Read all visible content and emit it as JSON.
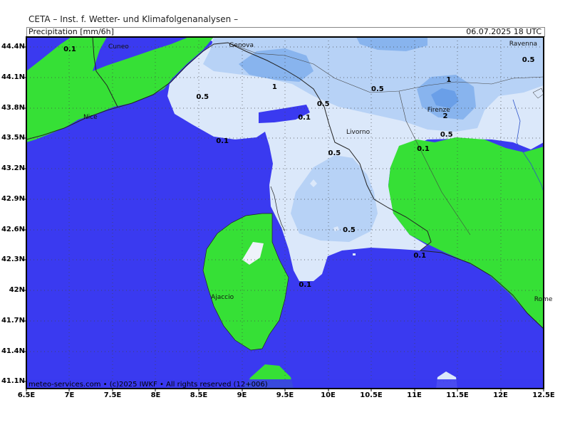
{
  "header": {
    "title": "CETA – Inst. f. Wetter- und Klimafolgenanalysen –",
    "parameter": "Precipitation [mm/6h]",
    "datetime": "06.07.2025 18 UTC"
  },
  "footer": {
    "credit": "meteo-services.com • (c)2025 IWKF • All rights reserved (12+006)"
  },
  "axes": {
    "lat_labels": [
      {
        "text": "44.4N",
        "value": 44.4
      },
      {
        "text": "44.1N",
        "value": 44.1
      },
      {
        "text": "43.8N",
        "value": 43.8
      },
      {
        "text": "43.5N",
        "value": 43.5
      },
      {
        "text": "43.2N",
        "value": 43.2
      },
      {
        "text": "42.9N",
        "value": 42.9
      },
      {
        "text": "42.6N",
        "value": 42.6
      },
      {
        "text": "42.3N",
        "value": 42.3
      },
      {
        "text": "42N",
        "value": 42.0
      },
      {
        "text": "41.7N",
        "value": 41.7
      },
      {
        "text": "41.4N",
        "value": 41.4
      },
      {
        "text": "41.1N",
        "value": 41.1
      }
    ],
    "lon_labels": [
      {
        "text": "6.5E",
        "value": 6.5
      },
      {
        "text": "7E",
        "value": 7.0
      },
      {
        "text": "7.5E",
        "value": 7.5
      },
      {
        "text": "8E",
        "value": 8.0
      },
      {
        "text": "8.5E",
        "value": 8.5
      },
      {
        "text": "9E",
        "value": 9.0
      },
      {
        "text": "9.5E",
        "value": 9.5
      },
      {
        "text": "10E",
        "value": 10.0
      },
      {
        "text": "10.5E",
        "value": 10.5
      },
      {
        "text": "11E",
        "value": 11.0
      },
      {
        "text": "11.5E",
        "value": 11.5
      },
      {
        "text": "12E",
        "value": 12.0
      },
      {
        "text": "12.5E",
        "value": 12.5
      }
    ]
  },
  "cities": [
    {
      "name": "Cuneo",
      "lon": 7.55,
      "lat": 44.39
    },
    {
      "name": "Genova",
      "lon": 8.95,
      "lat": 44.41
    },
    {
      "name": "Ravenna",
      "lon": 12.2,
      "lat": 44.42
    },
    {
      "name": "Nice",
      "lon": 7.26,
      "lat": 43.7
    },
    {
      "name": "Firenze",
      "lon": 11.25,
      "lat": 43.77
    },
    {
      "name": "Livorno",
      "lon": 10.31,
      "lat": 43.55
    },
    {
      "name": "Ajaccio",
      "lon": 8.74,
      "lat": 41.92
    },
    {
      "name": "Rome",
      "lon": 12.49,
      "lat": 41.9
    }
  ],
  "contour_labels": [
    {
      "text": "0.1",
      "lon": 6.98,
      "lat": 44.37
    },
    {
      "text": "0.5",
      "lon": 12.3,
      "lat": 44.27
    },
    {
      "text": "1",
      "lon": 9.4,
      "lat": 44.0
    },
    {
      "text": "1",
      "lon": 11.42,
      "lat": 44.07
    },
    {
      "text": "0.5",
      "lon": 10.55,
      "lat": 43.98
    },
    {
      "text": "0.5",
      "lon": 8.52,
      "lat": 43.9
    },
    {
      "text": "0.5",
      "lon": 9.92,
      "lat": 43.83
    },
    {
      "text": "0.1",
      "lon": 9.7,
      "lat": 43.7
    },
    {
      "text": "2",
      "lon": 11.38,
      "lat": 43.71
    },
    {
      "text": "0.5",
      "lon": 11.35,
      "lat": 43.53
    },
    {
      "text": "0.1",
      "lon": 8.75,
      "lat": 43.47
    },
    {
      "text": "0.1",
      "lon": 11.08,
      "lat": 43.39
    },
    {
      "text": "0.5",
      "lon": 10.05,
      "lat": 43.35
    },
    {
      "text": "0.5",
      "lon": 10.22,
      "lat": 42.59
    },
    {
      "text": "0.1",
      "lon": 11.04,
      "lat": 42.34
    },
    {
      "text": "0.1",
      "lon": 9.71,
      "lat": 42.05
    }
  ],
  "legend_colors": {
    "sea": "#3a3af0",
    "land_dry": "#36e036",
    "precip_0_1": "#dbe8fa",
    "precip_0_5": "#b7d2f6",
    "precip_1": "#88b4ee",
    "precip_2": "#6a9fe8",
    "island_white": "#eef2fa"
  }
}
